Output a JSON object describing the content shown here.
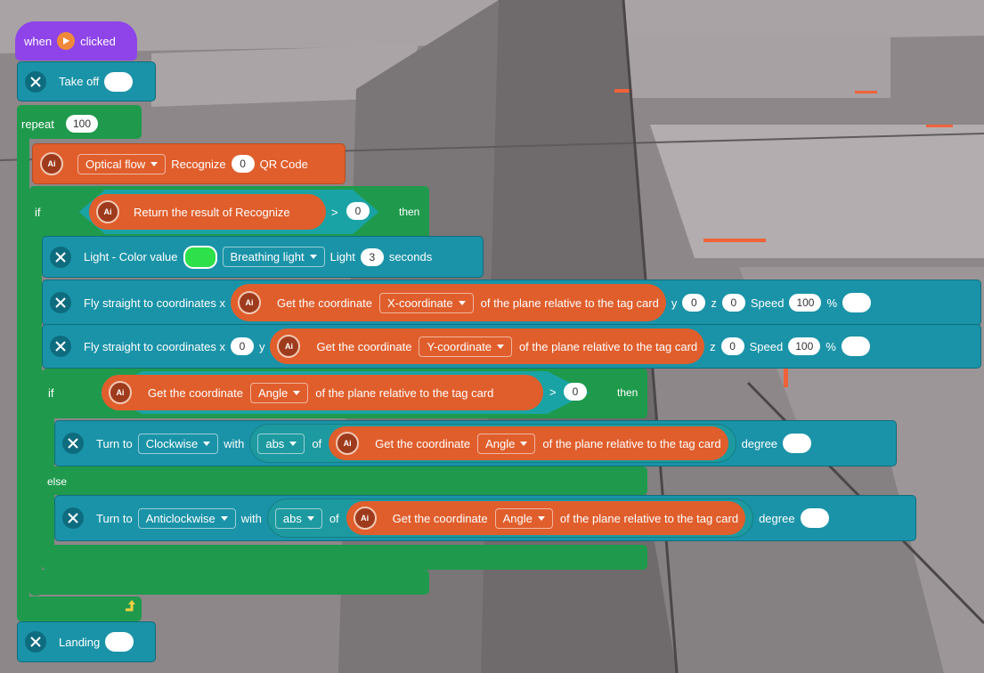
{
  "hat": {
    "when": "when",
    "clicked": "clicked",
    "flag_color": "#f08a3a"
  },
  "takeoff": {
    "label": "Take off"
  },
  "repeat": {
    "label": "repeat",
    "count": "100"
  },
  "optical": {
    "mode": "Optical flow",
    "recognize": "Recognize",
    "value": "0",
    "target": "QR Code"
  },
  "if1": {
    "if_label": "if",
    "reporter": "Return the result of Recognize",
    "op": ">",
    "value": "0",
    "then": "then"
  },
  "light": {
    "label": "Light - Color value",
    "color": "#2ee04a",
    "effect": "Breathing light",
    "light_label": "Light",
    "seconds_value": "3",
    "seconds_label": "seconds"
  },
  "fly1": {
    "label": "Fly straight to coordinates x",
    "get": "Get the coordinate",
    "axis": "X-coordinate",
    "relative": "of the plane relative to the tag card",
    "y_label": "y",
    "y": "0",
    "z_label": "z",
    "z": "0",
    "speed_label": "Speed",
    "speed": "100",
    "pct": "%"
  },
  "fly2": {
    "label": "Fly straight to coordinates x",
    "x": "0",
    "y_label": "y",
    "get": "Get the coordinate",
    "axis": "Y-coordinate",
    "relative": "of the plane relative to the tag card",
    "z_label": "z",
    "z": "0",
    "speed_label": "Speed",
    "speed": "100",
    "pct": "%"
  },
  "if2": {
    "if_label": "if",
    "get": "Get the coordinate",
    "axis": "Angle",
    "relative": "of the plane relative to the tag card",
    "op": ">",
    "value": "0",
    "then": "then",
    "else": "else"
  },
  "turn1": {
    "label": "Turn to",
    "dir": "Clockwise",
    "with": "with",
    "func": "abs",
    "of": "of",
    "get": "Get the coordinate",
    "axis": "Angle",
    "relative": "of the plane relative to the tag card",
    "degree": "degree"
  },
  "turn2": {
    "label": "Turn to",
    "dir": "Anticlockwise",
    "with": "with",
    "func": "abs",
    "of": "of",
    "get": "Get the coordinate",
    "axis": "Angle",
    "relative": "of the plane relative to the tag card",
    "degree": "degree"
  },
  "landing": {
    "label": "Landing"
  },
  "ai_text": "Ai",
  "colors": {
    "event": "#8e44e8",
    "motion": "#1a93a8",
    "control": "#1f9a4c",
    "ai": "#e05e2c"
  }
}
